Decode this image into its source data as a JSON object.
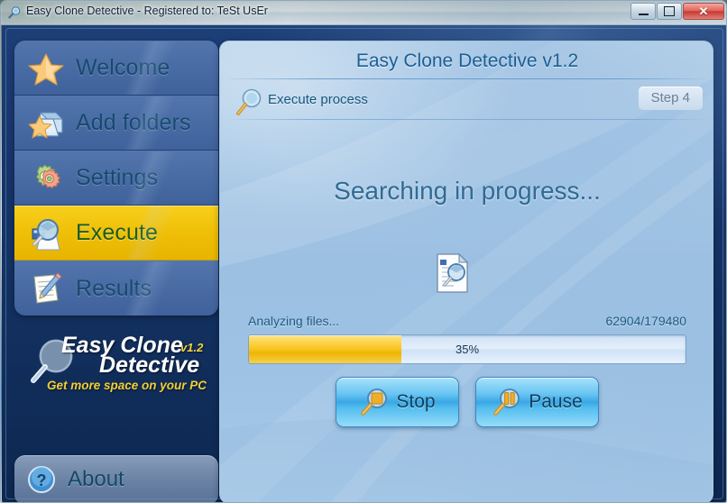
{
  "window": {
    "title": "Easy Clone Detective - Registered to: TeSt UsEr",
    "title_icon": "magnifier-icon",
    "minimize_label": "",
    "maximize_label": "",
    "close_label": "✕"
  },
  "sidebar": {
    "items": [
      {
        "label": "Welcome",
        "icon": "star-icon",
        "active": false
      },
      {
        "label": "Add folders",
        "icon": "folder-star-icon",
        "active": false
      },
      {
        "label": "Settings",
        "icon": "gears-icon",
        "active": false
      },
      {
        "label": "Execute",
        "icon": "magnifier-scan-icon",
        "active": true
      },
      {
        "label": "Results",
        "icon": "notepad-pencil-icon",
        "active": false
      }
    ],
    "logo": {
      "line1": "Easy Clone",
      "line2": "Detective",
      "version": "v1.2",
      "tagline": "Get more space on your PC",
      "icon": "magnifier-icon"
    },
    "about": {
      "label": "About",
      "icon": "question-mark-icon"
    }
  },
  "main": {
    "title": "Easy Clone Detective v1.2",
    "section_label": "Execute process",
    "section_icon": "magnifier-icon",
    "step_badge": "Step 4",
    "headline": "Searching in progress...",
    "center_icon": "document-search-icon",
    "progress": {
      "label": "Analyzing files...",
      "counter": "62904/179480",
      "percent_text": "35%",
      "percent": 35
    },
    "buttons": [
      {
        "label": "Stop",
        "icon": "magnifier-stop-icon"
      },
      {
        "label": "Pause",
        "icon": "magnifier-pause-icon"
      }
    ]
  },
  "colors": {
    "accent_gold": "#efbe06",
    "panel_blue": "#9cc0e2",
    "sidebar_navy": "#14336a",
    "nav_blue": "#5678b0",
    "text_blue": "#164a6e",
    "active_text_green": "#1a5c1e"
  }
}
